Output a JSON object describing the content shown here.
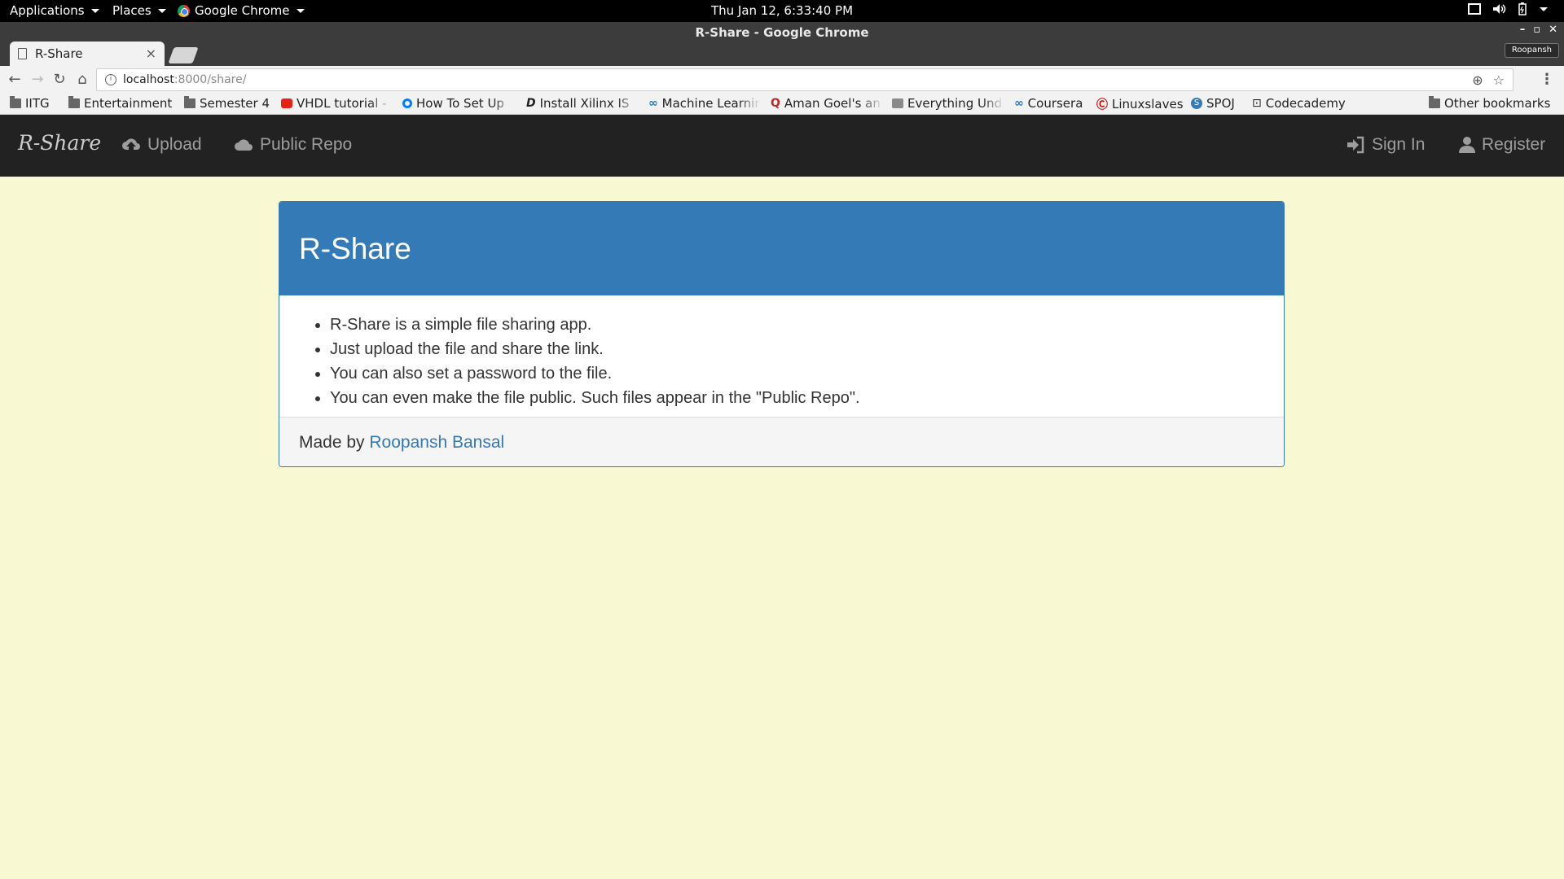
{
  "desktop": {
    "applications_label": "Applications",
    "places_label": "Places",
    "app_menu_label": "Google Chrome",
    "clock": "Thu Jan 12,  6:33:40 PM"
  },
  "browser": {
    "window_title": "R-Share - Google Chrome",
    "tab_title": "R-Share",
    "profile_name": "Roopansh",
    "url_host": "localhost",
    "url_path": ":8000/share/",
    "bookmarks": [
      {
        "label": "IITG",
        "icon": "folder-icon"
      },
      {
        "label": "Entertainment",
        "icon": "folder-icon"
      },
      {
        "label": "Semester 4",
        "icon": "folder-icon"
      },
      {
        "label": "VHDL tutorial -",
        "icon": "youtube-icon"
      },
      {
        "label": "How To Set Up",
        "icon": "digitalocean-icon"
      },
      {
        "label": "Install Xilinx IS",
        "icon": "d-icon"
      },
      {
        "label": "Machine Learnir",
        "icon": "coursera-icon"
      },
      {
        "label": "Aman Goel's an:",
        "icon": "quora-icon"
      },
      {
        "label": "Everything Und",
        "icon": "page-icon"
      },
      {
        "label": "Coursera",
        "icon": "coursera-icon"
      },
      {
        "label": "Linuxslaves",
        "icon": "linuxslaves-icon"
      },
      {
        "label": "SPOJ",
        "icon": "spoj-icon"
      },
      {
        "label": "Codecademy",
        "icon": "codecademy-icon"
      }
    ],
    "other_bookmarks": "Other bookmarks"
  },
  "app": {
    "brand": "R-Share",
    "nav": {
      "upload": "Upload",
      "public_repo": "Public Repo",
      "sign_in": "Sign In",
      "register": "Register"
    },
    "panel": {
      "title": "R-Share",
      "items": [
        "R-Share is a simple file sharing app.",
        "Just upload the file and share the link.",
        "You can also set a password to the file.",
        "You can even make the file public. Such files appear in the \"Public Repo\"."
      ],
      "footer_prefix": "Made by ",
      "footer_author": "Roopansh Bansal"
    }
  },
  "colors": {
    "primary": "#337ab7",
    "navbar_bg": "#222222",
    "page_bg": "#f8f8d2"
  }
}
